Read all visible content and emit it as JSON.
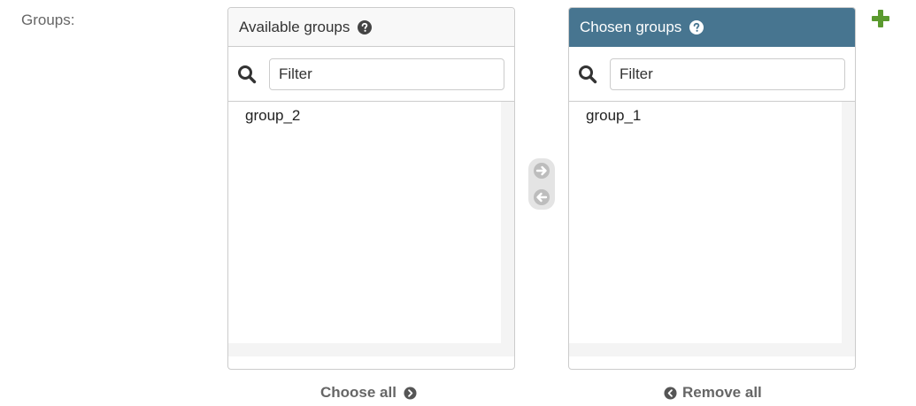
{
  "field": {
    "label": "Groups:"
  },
  "available": {
    "title": "Available groups",
    "filter_placeholder": "Filter",
    "options": [
      "group_2"
    ],
    "choose_all_label": "Choose all"
  },
  "chosen": {
    "title": "Chosen groups",
    "filter_placeholder": "Filter",
    "options": [
      "group_1"
    ],
    "remove_all_label": "Remove all"
  },
  "icons": {
    "help": "question-circle-icon",
    "search": "search-icon",
    "add_arrow": "arrow-right-circle-icon",
    "remove_arrow": "arrow-left-circle-icon",
    "add_related": "plus-icon"
  },
  "colors": {
    "chosen_header": "#477590",
    "add_related": "#5b9a2f"
  }
}
